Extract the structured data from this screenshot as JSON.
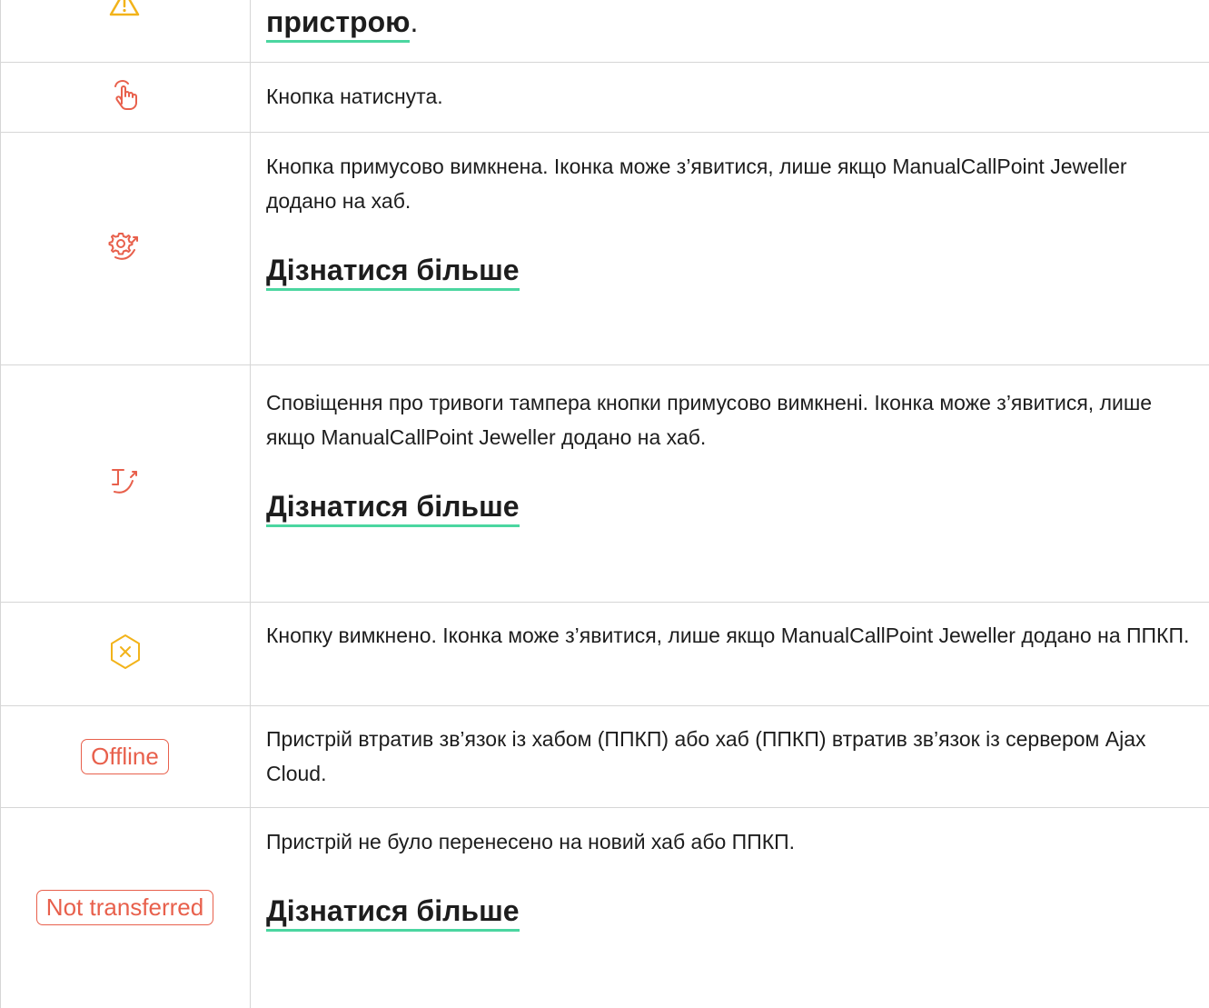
{
  "rows": [
    {
      "icon": "warning-icon",
      "link": "пристрою",
      "after": "."
    },
    {
      "icon": "tap-icon",
      "text": "Кнопка натиснута."
    },
    {
      "icon": "gear-bypass-icon",
      "text": "Кнопка примусово вимкнена. Іконка може з’явитися, лише якщо ManualCallPoint Jeweller додано на хаб.",
      "link": "Дізнатися більше"
    },
    {
      "icon": "tamper-bypass-icon",
      "text": "Сповіщення про тривоги тампера кнопки примусово вимкнені. Іконка може з’явитися, лише якщо ManualCallPoint Jeweller додано на хаб.",
      "link": "Дізнатися більше"
    },
    {
      "icon": "disabled-octagon-icon",
      "text": "Кнопку вимкнено. Іконка може з’явитися, лише якщо ManualCallPoint Jeweller додано на ППКП."
    },
    {
      "badge": "Offline",
      "text": "Пристрій втратив зв’язок із хабом (ППКП) або хаб (ППКП) втратив зв’язок із сервером Ajax Cloud."
    },
    {
      "badge": "Not transferred",
      "text": "Пристрій не було перенесено на новий хаб або ППКП.",
      "link": "Дізнатися більше"
    }
  ],
  "colors": {
    "icon_red": "#e8604c",
    "icon_yellow": "#f2b31a",
    "link_underline": "#4bd6a0"
  }
}
